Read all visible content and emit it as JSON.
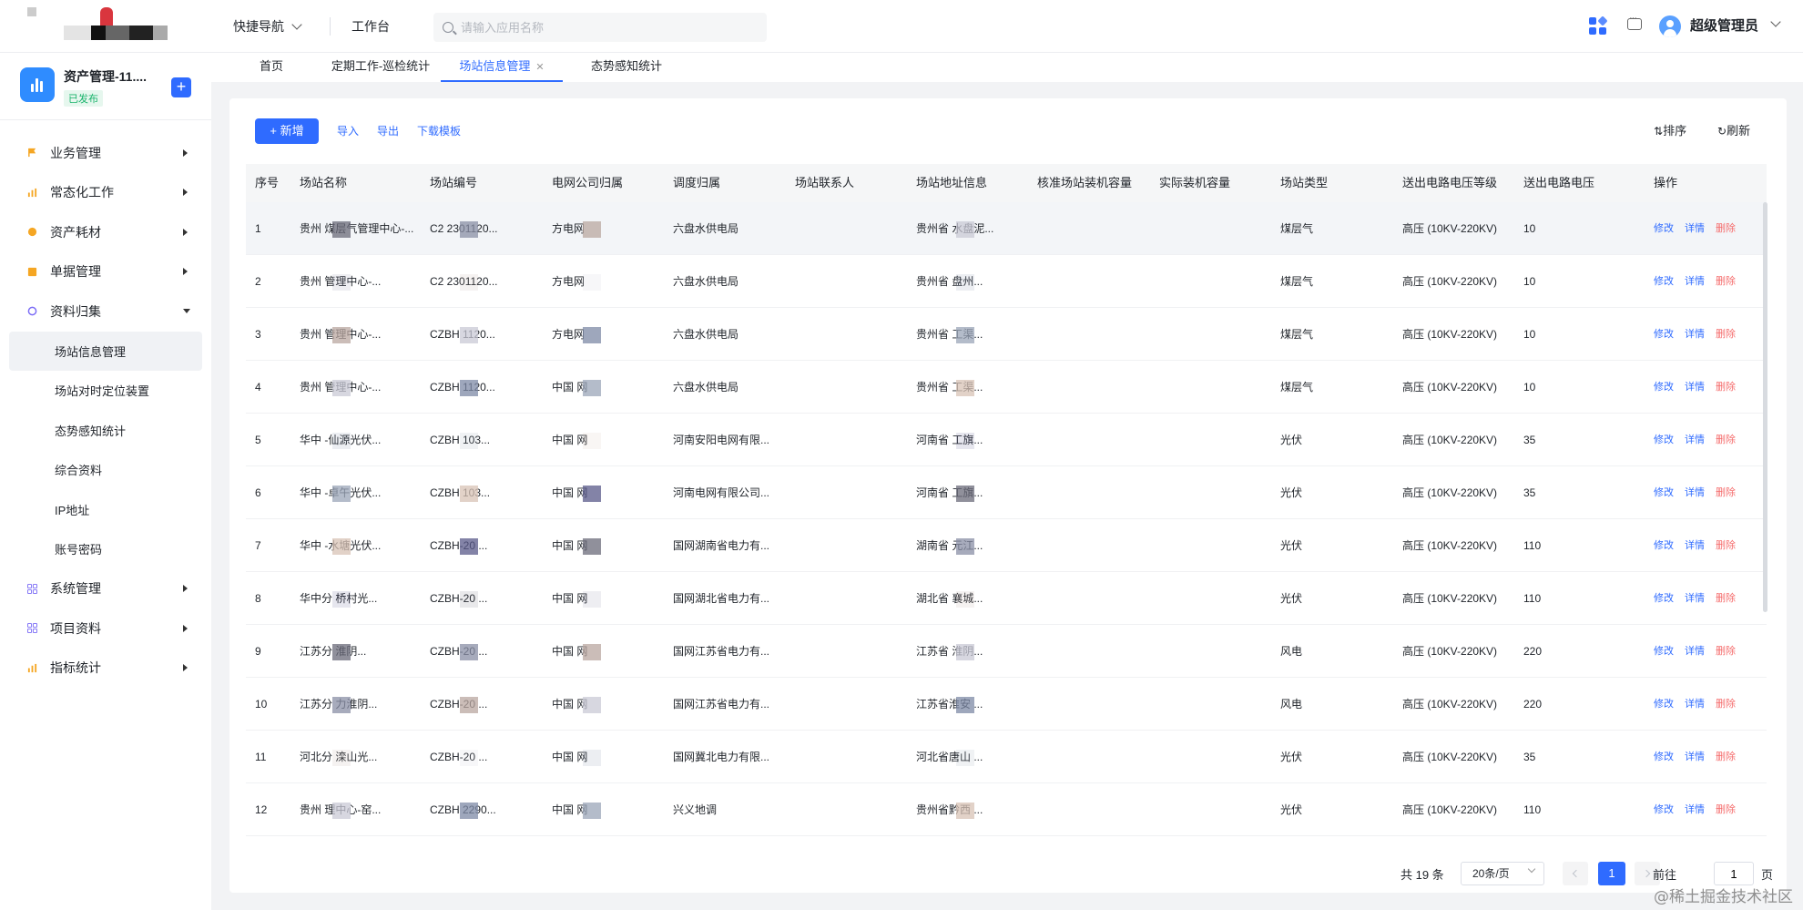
{
  "topbar": {
    "quick_nav": "快捷导航",
    "workbench": "工作台",
    "search_placeholder": "请输入应用名称",
    "username": "超级管理员"
  },
  "app": {
    "name": "资产管理-11....",
    "status": "已发布"
  },
  "sidebar": {
    "items": [
      {
        "label": "业务管理",
        "icon": "flag-icon",
        "color": "#f5a623"
      },
      {
        "label": "常态化工作",
        "icon": "chart-icon",
        "color": "#f5a623"
      },
      {
        "label": "资产耗材",
        "icon": "box-icon",
        "color": "#f5a623"
      },
      {
        "label": "单据管理",
        "icon": "file-icon",
        "color": "#f5a623"
      },
      {
        "label": "资料归集",
        "icon": "folder-icon",
        "color": "#7b6cf6"
      }
    ],
    "subitems": [
      "场站信息管理",
      "场站对时定位装置",
      "态势感知统计",
      "综合资料",
      "IP地址",
      "账号密码"
    ],
    "items_after": [
      {
        "label": "系统管理",
        "icon": "grid-icon",
        "color": "#7b6cf6"
      },
      {
        "label": "项目资料",
        "icon": "grid-icon",
        "color": "#7b6cf6"
      },
      {
        "label": "指标统计",
        "icon": "bar-icon",
        "color": "#f5a623"
      }
    ]
  },
  "tabs": [
    "首页",
    "定期工作-巡检统计",
    "场站信息管理",
    "态势感知统计"
  ],
  "toolbar": {
    "add": "+ 新增",
    "import": "导入",
    "export": "导出",
    "download_template": "下载模板",
    "sort": "排序",
    "refresh": "刷新"
  },
  "table": {
    "columns": [
      "序号",
      "场站名称",
      "场站编号",
      "电网公司归属",
      "调度归属",
      "场站联系人",
      "场站地址信息",
      "核准场站装机容量",
      "实际装机容量",
      "场站类型",
      "送出电路电压等级",
      "送出电路电压",
      "操作"
    ],
    "actions": {
      "edit": "修改",
      "detail": "详情",
      "delete": "删除"
    },
    "rows": [
      {
        "no": "1",
        "name": "贵州   煤层气管理中心-...",
        "code": "C2    2301120...",
        "grid": "   方电网",
        "dispatch": "六盘水供电局",
        "contact": "",
        "address": "贵州省   水盘泥...",
        "approved": "",
        "actual": "",
        "type": "煤层气",
        "level": "高压 (10KV-220KV)",
        "voltage": "10"
      },
      {
        "no": "2",
        "name": "贵州   管理中心-...",
        "code": "C2    2301120...",
        "grid": "   方电网",
        "dispatch": "六盘水供电局",
        "contact": "",
        "address": "贵州省   盘州...",
        "approved": "",
        "actual": "",
        "type": "煤层气",
        "level": "高压 (10KV-220KV)",
        "voltage": "10"
      },
      {
        "no": "3",
        "name": "贵州   管理中心-...",
        "code": "CZBH    1120...",
        "grid": "   方电网",
        "dispatch": "六盘水供电局",
        "contact": "",
        "address": "贵州省   工渠...",
        "approved": "",
        "actual": "",
        "type": "煤层气",
        "level": "高压 (10KV-220KV)",
        "voltage": "10"
      },
      {
        "no": "4",
        "name": "贵州   管理中心-...",
        "code": "CZBH    1120...",
        "grid": "中国   网",
        "dispatch": "六盘水供电局",
        "contact": "",
        "address": "贵州省   工渠...",
        "approved": "",
        "actual": "",
        "type": "煤层气",
        "level": "高压 (10KV-220KV)",
        "voltage": "10"
      },
      {
        "no": "5",
        "name": "华中   -仙源光伏...",
        "code": "CZBH    103...",
        "grid": "中国   网",
        "dispatch": "河南安阳电网有限...",
        "contact": "",
        "address": "河南省   工旗...",
        "approved": "",
        "actual": "",
        "type": "光伏",
        "level": "高压 (10KV-220KV)",
        "voltage": "35"
      },
      {
        "no": "6",
        "name": "华中   -卓午光伏...",
        "code": "CZBH    103...",
        "grid": "中国   网",
        "dispatch": "河南电网有限公司...",
        "contact": "",
        "address": "河南省   工旗...",
        "approved": "",
        "actual": "",
        "type": "光伏",
        "level": "高压 (10KV-220KV)",
        "voltage": "35"
      },
      {
        "no": "7",
        "name": "华中   -水塘光伏...",
        "code": "CZBH-20   ...",
        "grid": "中国   网",
        "dispatch": "国网湖南省电力有...",
        "contact": "",
        "address": "湖南省   元江...",
        "approved": "",
        "actual": "",
        "type": "光伏",
        "level": "高压 (10KV-220KV)",
        "voltage": "110"
      },
      {
        "no": "8",
        "name": "华中分   桥村光...",
        "code": "CZBH-20   ...",
        "grid": "中国   网",
        "dispatch": "国网湖北省电力有...",
        "contact": "",
        "address": "湖北省   襄城...",
        "approved": "",
        "actual": "",
        "type": "光伏",
        "level": "高压 (10KV-220KV)",
        "voltage": "110"
      },
      {
        "no": "9",
        "name": "江苏分   淮阴...",
        "code": "CZBH-20   ...",
        "grid": "中国   网",
        "dispatch": "国网江苏省电力有...",
        "contact": "",
        "address": "江苏省   淮阴...",
        "approved": "",
        "actual": "",
        "type": "风电",
        "level": "高压 (10KV-220KV)",
        "voltage": "220"
      },
      {
        "no": "10",
        "name": "江苏分   力淮阴...",
        "code": "CZBH-20   ...",
        "grid": "中国   网",
        "dispatch": "国网江苏省电力有...",
        "contact": "",
        "address": "江苏省淮安   ...",
        "approved": "",
        "actual": "",
        "type": "风电",
        "level": "高压 (10KV-220KV)",
        "voltage": "220"
      },
      {
        "no": "11",
        "name": "河北分   滦山光...",
        "code": "CZBH-20   ...",
        "grid": "中国   网",
        "dispatch": "国网冀北电力有限...",
        "contact": "",
        "address": "河北省唐山   ...",
        "approved": "",
        "actual": "",
        "type": "光伏",
        "level": "高压 (10KV-220KV)",
        "voltage": "35"
      },
      {
        "no": "12",
        "name": "贵州   理中心-窑...",
        "code": "CZBH    2290...",
        "grid": "中国   网",
        "dispatch": "兴义地调",
        "contact": "",
        "address": "贵州省黔西   ...",
        "approved": "",
        "actual": "",
        "type": "光伏",
        "level": "高压 (10KV-220KV)",
        "voltage": "110"
      }
    ]
  },
  "pagination": {
    "total": "共 19 条",
    "page_size": "20条/页",
    "current": "1",
    "goto": "前往",
    "goto_value": "1",
    "unit": "页"
  },
  "watermark": "@稀土掘金技术社区",
  "colors": {
    "accent": "#2f6bff",
    "danger": "#f56c6c",
    "published": "#19b36b"
  }
}
